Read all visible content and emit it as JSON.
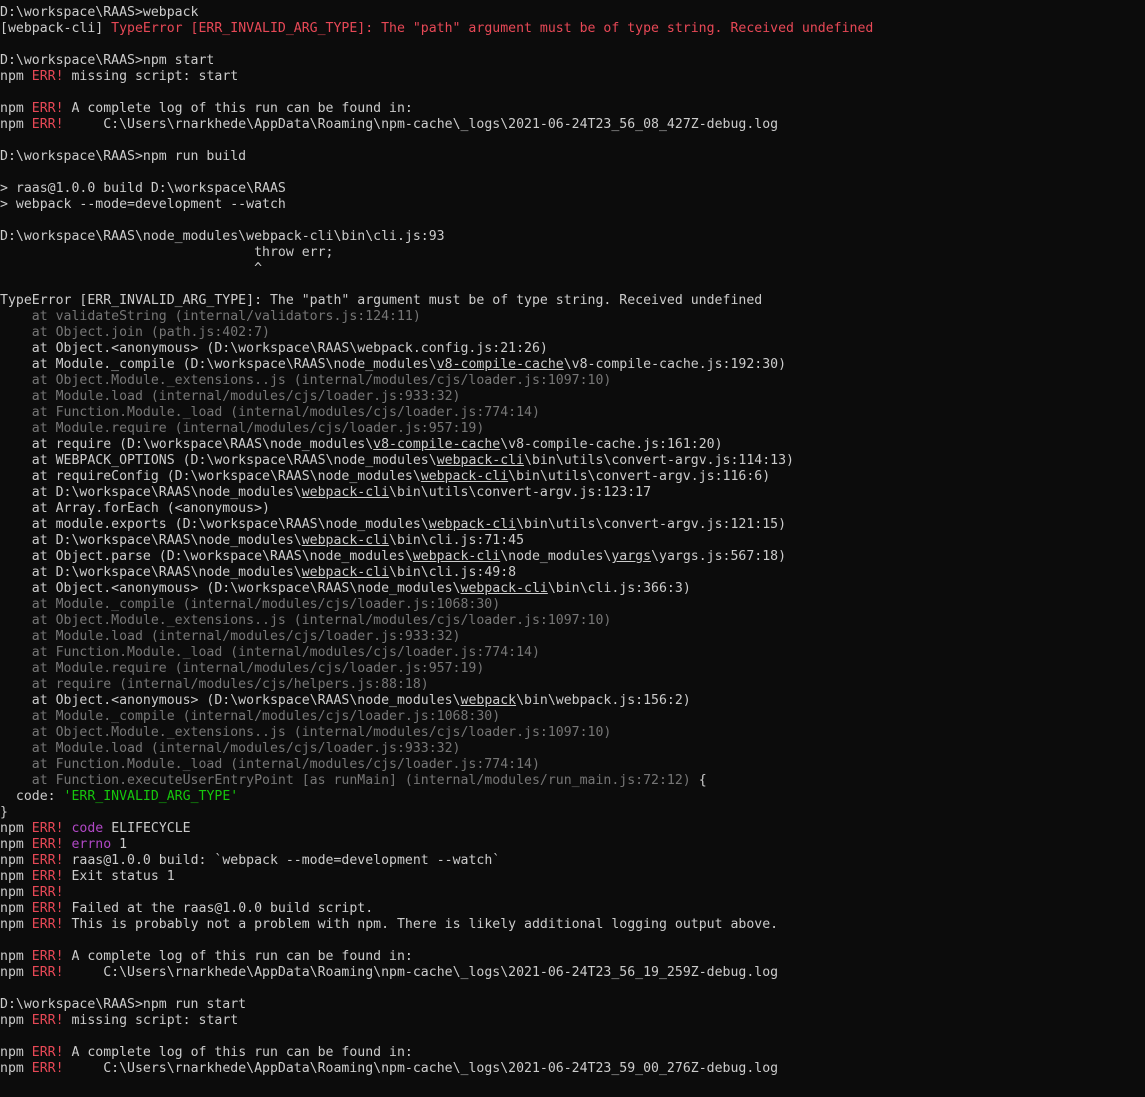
{
  "colors": {
    "background": "#0c0c0c",
    "default": "#cccccc",
    "red": "#e74856",
    "gray": "#767676",
    "magenta": "#b148c6",
    "green": "#16c60c"
  },
  "lines": [
    [
      [
        "n",
        "D:\\workspace\\RAAS>webpack"
      ]
    ],
    [
      [
        "n",
        "[webpack-cli] "
      ],
      [
        "r",
        "TypeError [ERR_INVALID_ARG_TYPE]: The \"path\" argument must be of type string. Received undefined"
      ]
    ],
    [],
    [
      [
        "n",
        "D:\\workspace\\RAAS>npm start"
      ]
    ],
    [
      [
        "n",
        "npm "
      ],
      [
        "r",
        "ERR!"
      ],
      [
        "n",
        " missing script: start"
      ]
    ],
    [],
    [
      [
        "n",
        "npm "
      ],
      [
        "r",
        "ERR!"
      ],
      [
        "n",
        " A complete log of this run can be found in:"
      ]
    ],
    [
      [
        "n",
        "npm "
      ],
      [
        "r",
        "ERR!"
      ],
      [
        "n",
        "     C:\\Users\\rnarkhede\\AppData\\Roaming\\npm-cache\\_logs\\2021-06-24T23_56_08_427Z-debug.log"
      ]
    ],
    [],
    [
      [
        "n",
        "D:\\workspace\\RAAS>npm run build"
      ]
    ],
    [],
    [
      [
        "n",
        "> raas@1.0.0 build D:\\workspace\\RAAS"
      ]
    ],
    [
      [
        "n",
        "> webpack --mode=development --watch"
      ]
    ],
    [],
    [
      [
        "n",
        "D:\\workspace\\RAAS\\node_modules\\webpack-cli\\bin\\cli.js:93"
      ]
    ],
    [
      [
        "n",
        "                                throw err;"
      ]
    ],
    [
      [
        "n",
        "                                ^"
      ]
    ],
    [],
    [
      [
        "n",
        "TypeError [ERR_INVALID_ARG_TYPE]: The \"path\" argument must be of type string. Received undefined"
      ]
    ],
    [
      [
        "g",
        "    at validateString (internal/validators.js:124:11)"
      ]
    ],
    [
      [
        "g",
        "    at Object.join (path.js:402:7)"
      ]
    ],
    [
      [
        "n",
        "    at Object.<anonymous> (D:\\workspace\\RAAS\\webpack.config.js:21:26)"
      ]
    ],
    [
      [
        "n",
        "    at Module._compile (D:\\workspace\\RAAS\\node_modules\\"
      ],
      [
        "u",
        "v8-compile-cache"
      ],
      [
        "n",
        "\\v8-compile-cache.js:192:30)"
      ]
    ],
    [
      [
        "g",
        "    at Object.Module._extensions..js (internal/modules/cjs/loader.js:1097:10)"
      ]
    ],
    [
      [
        "g",
        "    at Module.load (internal/modules/cjs/loader.js:933:32)"
      ]
    ],
    [
      [
        "g",
        "    at Function.Module._load (internal/modules/cjs/loader.js:774:14)"
      ]
    ],
    [
      [
        "g",
        "    at Module.require (internal/modules/cjs/loader.js:957:19)"
      ]
    ],
    [
      [
        "n",
        "    at require (D:\\workspace\\RAAS\\node_modules\\"
      ],
      [
        "u",
        "v8-compile-cache"
      ],
      [
        "n",
        "\\v8-compile-cache.js:161:20)"
      ]
    ],
    [
      [
        "n",
        "    at WEBPACK_OPTIONS (D:\\workspace\\RAAS\\node_modules\\"
      ],
      [
        "u",
        "webpack-cli"
      ],
      [
        "n",
        "\\bin\\utils\\convert-argv.js:114:13)"
      ]
    ],
    [
      [
        "n",
        "    at requireConfig (D:\\workspace\\RAAS\\node_modules\\"
      ],
      [
        "u",
        "webpack-cli"
      ],
      [
        "n",
        "\\bin\\utils\\convert-argv.js:116:6)"
      ]
    ],
    [
      [
        "n",
        "    at D:\\workspace\\RAAS\\node_modules\\"
      ],
      [
        "u",
        "webpack-cli"
      ],
      [
        "n",
        "\\bin\\utils\\convert-argv.js:123:17"
      ]
    ],
    [
      [
        "n",
        "    at Array.forEach (<anonymous>)"
      ]
    ],
    [
      [
        "n",
        "    at module.exports (D:\\workspace\\RAAS\\node_modules\\"
      ],
      [
        "u",
        "webpack-cli"
      ],
      [
        "n",
        "\\bin\\utils\\convert-argv.js:121:15)"
      ]
    ],
    [
      [
        "n",
        "    at D:\\workspace\\RAAS\\node_modules\\"
      ],
      [
        "u",
        "webpack-cli"
      ],
      [
        "n",
        "\\bin\\cli.js:71:45"
      ]
    ],
    [
      [
        "n",
        "    at Object.parse (D:\\workspace\\RAAS\\node_modules\\"
      ],
      [
        "u",
        "webpack-cli"
      ],
      [
        "n",
        "\\node_modules\\"
      ],
      [
        "u",
        "yargs"
      ],
      [
        "n",
        "\\yargs.js:567:18)"
      ]
    ],
    [
      [
        "n",
        "    at D:\\workspace\\RAAS\\node_modules\\"
      ],
      [
        "u",
        "webpack-cli"
      ],
      [
        "n",
        "\\bin\\cli.js:49:8"
      ]
    ],
    [
      [
        "n",
        "    at Object.<anonymous> (D:\\workspace\\RAAS\\node_modules\\"
      ],
      [
        "u",
        "webpack-cli"
      ],
      [
        "n",
        "\\bin\\cli.js:366:3)"
      ]
    ],
    [
      [
        "g",
        "    at Module._compile (internal/modules/cjs/loader.js:1068:30)"
      ]
    ],
    [
      [
        "g",
        "    at Object.Module._extensions..js (internal/modules/cjs/loader.js:1097:10)"
      ]
    ],
    [
      [
        "g",
        "    at Module.load (internal/modules/cjs/loader.js:933:32)"
      ]
    ],
    [
      [
        "g",
        "    at Function.Module._load (internal/modules/cjs/loader.js:774:14)"
      ]
    ],
    [
      [
        "g",
        "    at Module.require (internal/modules/cjs/loader.js:957:19)"
      ]
    ],
    [
      [
        "g",
        "    at require (internal/modules/cjs/helpers.js:88:18)"
      ]
    ],
    [
      [
        "n",
        "    at Object.<anonymous> (D:\\workspace\\RAAS\\node_modules\\"
      ],
      [
        "u",
        "webpack"
      ],
      [
        "n",
        "\\bin\\webpack.js:156:2)"
      ]
    ],
    [
      [
        "g",
        "    at Module._compile (internal/modules/cjs/loader.js:1068:30)"
      ]
    ],
    [
      [
        "g",
        "    at Object.Module._extensions..js (internal/modules/cjs/loader.js:1097:10)"
      ]
    ],
    [
      [
        "g",
        "    at Module.load (internal/modules/cjs/loader.js:933:32)"
      ]
    ],
    [
      [
        "g",
        "    at Function.Module._load (internal/modules/cjs/loader.js:774:14)"
      ]
    ],
    [
      [
        "g",
        "    at Function.executeUserEntryPoint [as runMain] (internal/modules/run_main.js:72:12)"
      ],
      [
        "n",
        " {"
      ]
    ],
    [
      [
        "n",
        "  code: "
      ],
      [
        "e",
        "'ERR_INVALID_ARG_TYPE'"
      ]
    ],
    [
      [
        "n",
        "}"
      ]
    ],
    [
      [
        "n",
        "npm "
      ],
      [
        "r",
        "ERR!"
      ],
      [
        "n",
        " "
      ],
      [
        "m",
        "code"
      ],
      [
        "n",
        " ELIFECYCLE"
      ]
    ],
    [
      [
        "n",
        "npm "
      ],
      [
        "r",
        "ERR!"
      ],
      [
        "n",
        " "
      ],
      [
        "m",
        "errno"
      ],
      [
        "n",
        " 1"
      ]
    ],
    [
      [
        "n",
        "npm "
      ],
      [
        "r",
        "ERR!"
      ],
      [
        "n",
        " raas@1.0.0 build: `webpack --mode=development --watch`"
      ]
    ],
    [
      [
        "n",
        "npm "
      ],
      [
        "r",
        "ERR!"
      ],
      [
        "n",
        " Exit status 1"
      ]
    ],
    [
      [
        "n",
        "npm "
      ],
      [
        "r",
        "ERR!"
      ]
    ],
    [
      [
        "n",
        "npm "
      ],
      [
        "r",
        "ERR!"
      ],
      [
        "n",
        " Failed at the raas@1.0.0 build script."
      ]
    ],
    [
      [
        "n",
        "npm "
      ],
      [
        "r",
        "ERR!"
      ],
      [
        "n",
        " This is probably not a problem with npm. There is likely additional logging output above."
      ]
    ],
    [],
    [
      [
        "n",
        "npm "
      ],
      [
        "r",
        "ERR!"
      ],
      [
        "n",
        " A complete log of this run can be found in:"
      ]
    ],
    [
      [
        "n",
        "npm "
      ],
      [
        "r",
        "ERR!"
      ],
      [
        "n",
        "     C:\\Users\\rnarkhede\\AppData\\Roaming\\npm-cache\\_logs\\2021-06-24T23_56_19_259Z-debug.log"
      ]
    ],
    [],
    [
      [
        "n",
        "D:\\workspace\\RAAS>npm run start"
      ]
    ],
    [
      [
        "n",
        "npm "
      ],
      [
        "r",
        "ERR!"
      ],
      [
        "n",
        " missing script: start"
      ]
    ],
    [],
    [
      [
        "n",
        "npm "
      ],
      [
        "r",
        "ERR!"
      ],
      [
        "n",
        " A complete log of this run can be found in:"
      ]
    ],
    [
      [
        "n",
        "npm "
      ],
      [
        "r",
        "ERR!"
      ],
      [
        "n",
        "     C:\\Users\\rnarkhede\\AppData\\Roaming\\npm-cache\\_logs\\2021-06-24T23_59_00_276Z-debug.log"
      ]
    ]
  ]
}
